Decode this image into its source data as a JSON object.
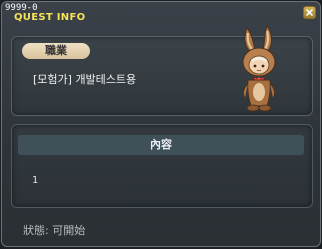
{
  "window": {
    "id_label": "9999-0",
    "title": "QUEST INFO"
  },
  "job": {
    "label": "職業",
    "name": "[모험가] 개발테스트용"
  },
  "content": {
    "header": "內容",
    "value": "1"
  },
  "status": {
    "text": "狀態: 可開始"
  },
  "colors": {
    "title": "#f6e35a",
    "pill": "#e6d4b2",
    "content_header": "#3f5058"
  },
  "icons": [
    "close-icon",
    "character-sprite"
  ]
}
